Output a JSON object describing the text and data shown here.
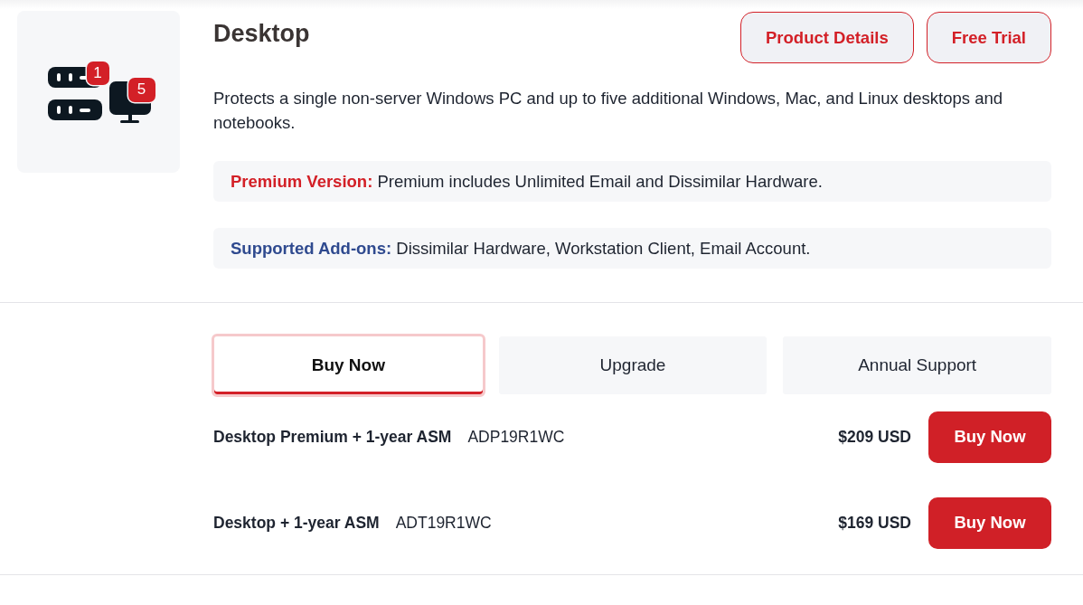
{
  "product": {
    "badges": [
      "1",
      "5"
    ],
    "title": "Desktop",
    "actions": [
      {
        "label": "Product Details"
      },
      {
        "label": "Free Trial"
      }
    ],
    "description": "Protects a single non-server Windows PC and up to five additional Windows, Mac, and Linux desktops and notebooks.",
    "notes": [
      {
        "kind": "premium",
        "text": "**Premium Version:** Premium includes Unlimited Email and Dissimilar Hardware."
      },
      {
        "kind": "addons",
        "text": "**Supported Add-ons:** Dissimilar Hardware, Workstation Client, Email Account."
      }
    ]
  },
  "tabs": [
    {
      "label": "Buy Now",
      "selected": true
    },
    {
      "label": "Upgrade",
      "selected": false
    },
    {
      "label": "Annual Support",
      "selected": false
    }
  ],
  "offers": [
    {
      "name": "Desktop Premium + 1-year ASM",
      "sku": "ADP19R1WC",
      "price": "$209 USD",
      "button": "Buy Now"
    },
    {
      "name": "Desktop + 1-year ASM",
      "sku": "ADT19R1WC",
      "price": "$169 USD",
      "button": "Buy Now"
    }
  ]
}
